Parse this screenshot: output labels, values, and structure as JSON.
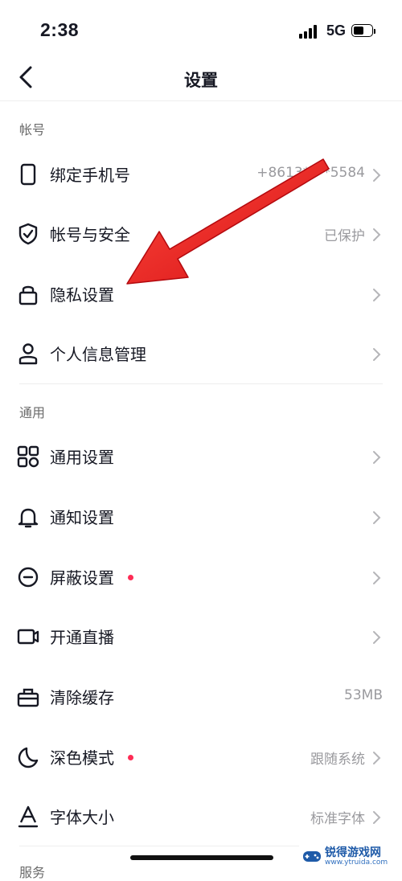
{
  "status_bar": {
    "time": "2:38",
    "network": "5G",
    "battery_level": 0.55
  },
  "nav": {
    "title": "设置"
  },
  "sections": [
    {
      "header": "帐号",
      "items": [
        {
          "label": "绑定手机号",
          "value": "+8613****5584",
          "icon": "phone-icon"
        },
        {
          "label": "帐号与安全",
          "value": "已保护",
          "icon": "shield-check-icon"
        },
        {
          "label": "隐私设置",
          "value": "",
          "icon": "lock-icon"
        },
        {
          "label": "个人信息管理",
          "value": "",
          "icon": "person-icon"
        }
      ]
    },
    {
      "header": "通用",
      "items": [
        {
          "label": "通用设置",
          "value": "",
          "icon": "grid-icon"
        },
        {
          "label": "通知设置",
          "value": "",
          "icon": "bell-icon"
        },
        {
          "label": "屏蔽设置",
          "value": "",
          "icon": "block-icon",
          "dot": true
        },
        {
          "label": "开通直播",
          "value": "",
          "icon": "video-camera-icon"
        },
        {
          "label": "清除缓存",
          "value": "53MB",
          "icon": "briefcase-icon"
        },
        {
          "label": "深色模式",
          "value": "跟随系统",
          "icon": "moon-icon",
          "dot": true
        },
        {
          "label": "字体大小",
          "value": "标准字体",
          "icon": "font-size-icon"
        }
      ]
    },
    {
      "header": "服务"
    }
  ],
  "watermark": {
    "title": "锐得游戏网",
    "url": "www.ytruida.com"
  },
  "colors": {
    "accent_dot": "#fe2c55",
    "annotation_arrow": "#e8141b",
    "secondary_text": "#9a9a9e"
  }
}
